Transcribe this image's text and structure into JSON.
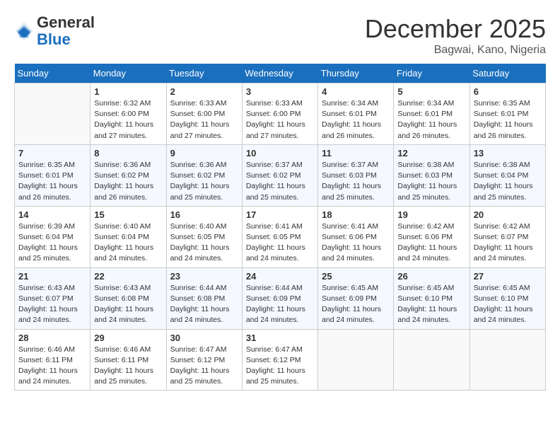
{
  "header": {
    "logo_general": "General",
    "logo_blue": "Blue",
    "month_title": "December 2025",
    "subtitle": "Bagwai, Kano, Nigeria"
  },
  "calendar": {
    "weekdays": [
      "Sunday",
      "Monday",
      "Tuesday",
      "Wednesday",
      "Thursday",
      "Friday",
      "Saturday"
    ],
    "weeks": [
      [
        {
          "day": "",
          "info": ""
        },
        {
          "day": "1",
          "info": "Sunrise: 6:32 AM\nSunset: 6:00 PM\nDaylight: 11 hours\nand 27 minutes."
        },
        {
          "day": "2",
          "info": "Sunrise: 6:33 AM\nSunset: 6:00 PM\nDaylight: 11 hours\nand 27 minutes."
        },
        {
          "day": "3",
          "info": "Sunrise: 6:33 AM\nSunset: 6:00 PM\nDaylight: 11 hours\nand 27 minutes."
        },
        {
          "day": "4",
          "info": "Sunrise: 6:34 AM\nSunset: 6:01 PM\nDaylight: 11 hours\nand 26 minutes."
        },
        {
          "day": "5",
          "info": "Sunrise: 6:34 AM\nSunset: 6:01 PM\nDaylight: 11 hours\nand 26 minutes."
        },
        {
          "day": "6",
          "info": "Sunrise: 6:35 AM\nSunset: 6:01 PM\nDaylight: 11 hours\nand 26 minutes."
        }
      ],
      [
        {
          "day": "7",
          "info": "Sunrise: 6:35 AM\nSunset: 6:01 PM\nDaylight: 11 hours\nand 26 minutes."
        },
        {
          "day": "8",
          "info": "Sunrise: 6:36 AM\nSunset: 6:02 PM\nDaylight: 11 hours\nand 26 minutes."
        },
        {
          "day": "9",
          "info": "Sunrise: 6:36 AM\nSunset: 6:02 PM\nDaylight: 11 hours\nand 25 minutes."
        },
        {
          "day": "10",
          "info": "Sunrise: 6:37 AM\nSunset: 6:02 PM\nDaylight: 11 hours\nand 25 minutes."
        },
        {
          "day": "11",
          "info": "Sunrise: 6:37 AM\nSunset: 6:03 PM\nDaylight: 11 hours\nand 25 minutes."
        },
        {
          "day": "12",
          "info": "Sunrise: 6:38 AM\nSunset: 6:03 PM\nDaylight: 11 hours\nand 25 minutes."
        },
        {
          "day": "13",
          "info": "Sunrise: 6:38 AM\nSunset: 6:04 PM\nDaylight: 11 hours\nand 25 minutes."
        }
      ],
      [
        {
          "day": "14",
          "info": "Sunrise: 6:39 AM\nSunset: 6:04 PM\nDaylight: 11 hours\nand 25 minutes."
        },
        {
          "day": "15",
          "info": "Sunrise: 6:40 AM\nSunset: 6:04 PM\nDaylight: 11 hours\nand 24 minutes."
        },
        {
          "day": "16",
          "info": "Sunrise: 6:40 AM\nSunset: 6:05 PM\nDaylight: 11 hours\nand 24 minutes."
        },
        {
          "day": "17",
          "info": "Sunrise: 6:41 AM\nSunset: 6:05 PM\nDaylight: 11 hours\nand 24 minutes."
        },
        {
          "day": "18",
          "info": "Sunrise: 6:41 AM\nSunset: 6:06 PM\nDaylight: 11 hours\nand 24 minutes."
        },
        {
          "day": "19",
          "info": "Sunrise: 6:42 AM\nSunset: 6:06 PM\nDaylight: 11 hours\nand 24 minutes."
        },
        {
          "day": "20",
          "info": "Sunrise: 6:42 AM\nSunset: 6:07 PM\nDaylight: 11 hours\nand 24 minutes."
        }
      ],
      [
        {
          "day": "21",
          "info": "Sunrise: 6:43 AM\nSunset: 6:07 PM\nDaylight: 11 hours\nand 24 minutes."
        },
        {
          "day": "22",
          "info": "Sunrise: 6:43 AM\nSunset: 6:08 PM\nDaylight: 11 hours\nand 24 minutes."
        },
        {
          "day": "23",
          "info": "Sunrise: 6:44 AM\nSunset: 6:08 PM\nDaylight: 11 hours\nand 24 minutes."
        },
        {
          "day": "24",
          "info": "Sunrise: 6:44 AM\nSunset: 6:09 PM\nDaylight: 11 hours\nand 24 minutes."
        },
        {
          "day": "25",
          "info": "Sunrise: 6:45 AM\nSunset: 6:09 PM\nDaylight: 11 hours\nand 24 minutes."
        },
        {
          "day": "26",
          "info": "Sunrise: 6:45 AM\nSunset: 6:10 PM\nDaylight: 11 hours\nand 24 minutes."
        },
        {
          "day": "27",
          "info": "Sunrise: 6:45 AM\nSunset: 6:10 PM\nDaylight: 11 hours\nand 24 minutes."
        }
      ],
      [
        {
          "day": "28",
          "info": "Sunrise: 6:46 AM\nSunset: 6:11 PM\nDaylight: 11 hours\nand 24 minutes."
        },
        {
          "day": "29",
          "info": "Sunrise: 6:46 AM\nSunset: 6:11 PM\nDaylight: 11 hours\nand 25 minutes."
        },
        {
          "day": "30",
          "info": "Sunrise: 6:47 AM\nSunset: 6:12 PM\nDaylight: 11 hours\nand 25 minutes."
        },
        {
          "day": "31",
          "info": "Sunrise: 6:47 AM\nSunset: 6:12 PM\nDaylight: 11 hours\nand 25 minutes."
        },
        {
          "day": "",
          "info": ""
        },
        {
          "day": "",
          "info": ""
        },
        {
          "day": "",
          "info": ""
        }
      ]
    ]
  }
}
